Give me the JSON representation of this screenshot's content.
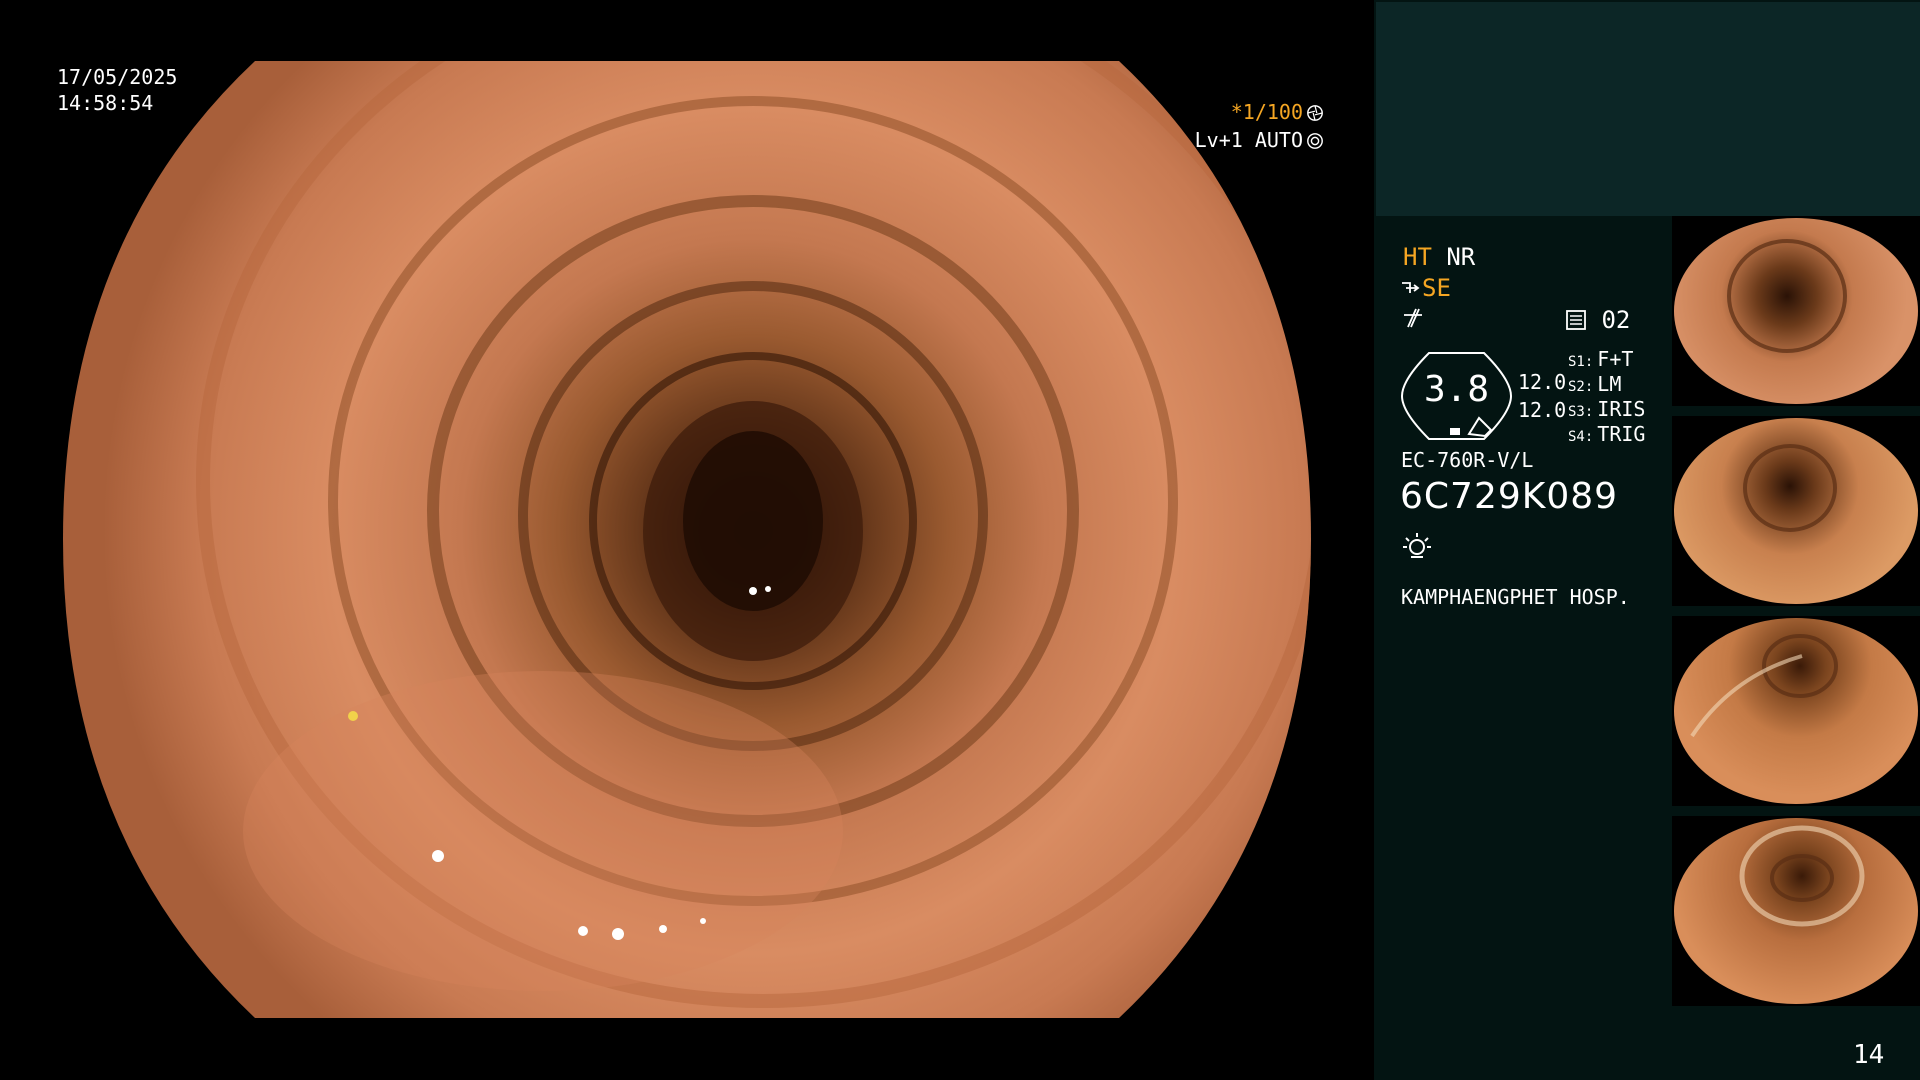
{
  "overlay": {
    "date": "17/05/2025",
    "time": "14:58:54",
    "shutter": "*1/100",
    "level_mode": "Lv+1 AUTO",
    "shutter_icon": "aperture-icon",
    "auto_icon": "auto-exposure-icon"
  },
  "panel": {
    "mode_ht": "HT",
    "mode_nr": "NR",
    "mode_se": "SE",
    "se_icon": "structure-enhance-icon",
    "freeze_icon": "freeze-icon",
    "memory_icon": "memory-card-icon",
    "memory_count": "02",
    "scope_value": "3.8",
    "channel_a": "12.0",
    "channel_b": "12.0",
    "switches": [
      {
        "tag": "S1:",
        "label": "F+T"
      },
      {
        "tag": "S2:",
        "label": "LM"
      },
      {
        "tag": "S3:",
        "label": "IRIS"
      },
      {
        "tag": "S4:",
        "label": "TRIG"
      }
    ],
    "scope_model": "EC-760R-V/L",
    "serial_number": "6C729K089",
    "light_icon": "light-source-icon",
    "hospital": "KAMPHAENGPHET HOSP.",
    "page_number": "14"
  },
  "colors": {
    "accent_amber": "#f5a623",
    "panel_bg": "#031412",
    "panel_header_bg": "#0c2626"
  },
  "thumbnails": [
    {
      "name": "thumb-1"
    },
    {
      "name": "thumb-2"
    },
    {
      "name": "thumb-3"
    },
    {
      "name": "thumb-4"
    }
  ]
}
